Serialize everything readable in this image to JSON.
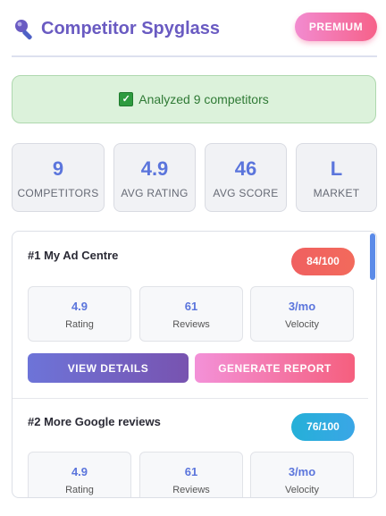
{
  "header": {
    "title": "Competitor Spyglass",
    "premium_label": "PREMIUM"
  },
  "status": {
    "check_glyph": "✓",
    "message": "Analyzed 9 competitors"
  },
  "stats": [
    {
      "value": "9",
      "label": "COMPETITORS"
    },
    {
      "value": "4.9",
      "label": "AVG RATING"
    },
    {
      "value": "46",
      "label": "AVG SCORE"
    },
    {
      "value": "L",
      "label": "MARKET"
    }
  ],
  "competitors": [
    {
      "title": "#1 My Ad Centre",
      "score": "84/100",
      "score_color": "#f06060",
      "metrics": [
        {
          "value": "4.9",
          "label": "Rating"
        },
        {
          "value": "61",
          "label": "Reviews"
        },
        {
          "value": "3/mo",
          "label": "Velocity"
        }
      ],
      "details_label": "VIEW DETAILS",
      "report_label": "GENERATE REPORT"
    },
    {
      "title": "#2 More Google reviews",
      "score": "76/100",
      "score_color": "#25b0d8",
      "metrics": [
        {
          "value": "4.9",
          "label": "Rating"
        },
        {
          "value": "61",
          "label": "Reviews"
        },
        {
          "value": "3/mo",
          "label": "Velocity"
        }
      ]
    }
  ],
  "colors": {
    "accent": "#5b75dc",
    "title": "#6a5bc2",
    "success_bg": "#dcf2db",
    "success_text": "#2f7a35"
  },
  "icons": {
    "logo": "magnifying-glass-icon",
    "status": "check-box-icon"
  }
}
